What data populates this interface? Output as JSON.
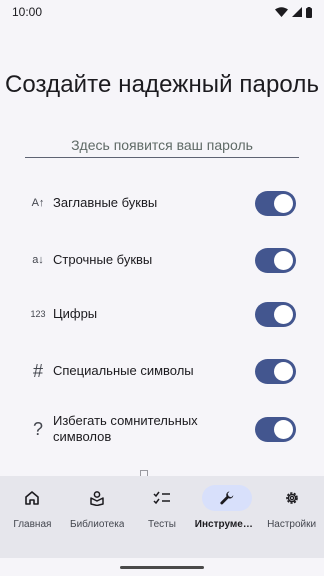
{
  "status_bar": {
    "time": "10:00"
  },
  "title": "Создайте надежный пароль",
  "password": {
    "placeholder": "Здесь появится ваш пароль"
  },
  "options": [
    {
      "icon": "uppercase-icon",
      "icon_text": "A↑",
      "label": "Заглавные буквы",
      "enabled": true
    },
    {
      "icon": "lowercase-icon",
      "icon_text": "a↓",
      "label": "Строчные буквы",
      "enabled": true
    },
    {
      "icon": "digits-icon",
      "icon_text": "123",
      "label": "Цифры",
      "enabled": true
    },
    {
      "icon": "hash-icon",
      "icon_text": "#",
      "label": "Специальные символы",
      "enabled": true
    },
    {
      "icon": "question-icon",
      "icon_text": "?",
      "label": "Избегать сомнительных символов",
      "enabled": true
    }
  ],
  "nav": {
    "items": [
      {
        "label": "Главная",
        "icon": "home-icon",
        "active": false
      },
      {
        "label": "Библиотека",
        "icon": "library-icon",
        "active": false
      },
      {
        "label": "Тесты",
        "icon": "checklist-icon",
        "active": false
      },
      {
        "label": "Инструменты",
        "icon": "wrench-icon",
        "active": true
      },
      {
        "label": "Настройки",
        "icon": "gear-icon",
        "active": false
      }
    ]
  },
  "colors": {
    "accent": "#43568f",
    "nav_active_pill": "#d8e0fb",
    "background": "#f6f5f9"
  }
}
